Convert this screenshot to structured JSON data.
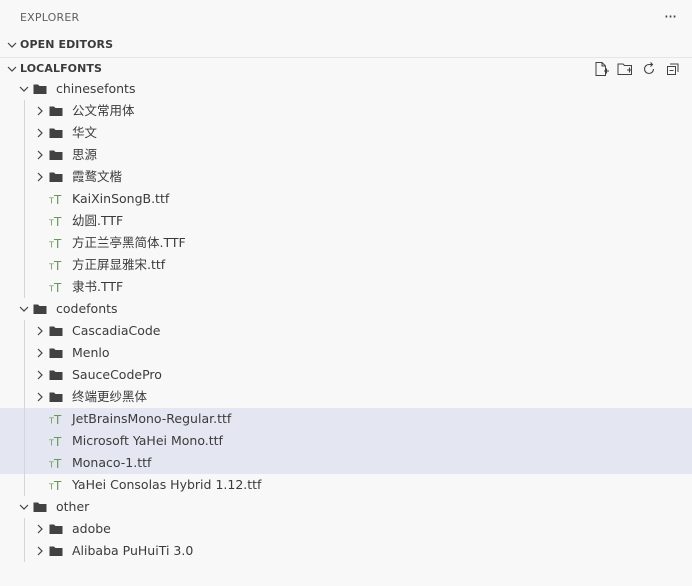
{
  "header": {
    "title": "EXPLORER",
    "more_icon": "ellipsis-icon"
  },
  "open_editors": {
    "title": "OPEN EDITORS"
  },
  "workspace": {
    "title": "LOCALFONTS",
    "actions": [
      "new-file-icon",
      "new-folder-icon",
      "refresh-icon",
      "collapse-all-icon"
    ]
  },
  "colors": {
    "background": "#f8f8f8",
    "selection": "#e4e6f1",
    "font_icon": "#6a9955",
    "folder_icon": "#424242"
  },
  "tree": [
    {
      "label": "chinesefonts",
      "type": "folder",
      "depth": 0,
      "expanded": true
    },
    {
      "label": "公文常用体",
      "type": "folder",
      "depth": 1,
      "expanded": false
    },
    {
      "label": "华文",
      "type": "folder",
      "depth": 1,
      "expanded": false
    },
    {
      "label": "思源",
      "type": "folder",
      "depth": 1,
      "expanded": false
    },
    {
      "label": "霞鹜文楷",
      "type": "folder",
      "depth": 1,
      "expanded": false
    },
    {
      "label": "KaiXinSongB.ttf",
      "type": "font",
      "depth": 1
    },
    {
      "label": "幼圆.TTF",
      "type": "font",
      "depth": 1
    },
    {
      "label": "方正兰亭黑简体.TTF",
      "type": "font",
      "depth": 1
    },
    {
      "label": "方正屏显雅宋.ttf",
      "type": "font",
      "depth": 1
    },
    {
      "label": "隶书.TTF",
      "type": "font",
      "depth": 1
    },
    {
      "label": "codefonts",
      "type": "folder",
      "depth": 0,
      "expanded": true
    },
    {
      "label": "CascadiaCode",
      "type": "folder",
      "depth": 1,
      "expanded": false
    },
    {
      "label": "Menlo",
      "type": "folder",
      "depth": 1,
      "expanded": false
    },
    {
      "label": "SauceCodePro",
      "type": "folder",
      "depth": 1,
      "expanded": false
    },
    {
      "label": "终端更纱黑体",
      "type": "folder",
      "depth": 1,
      "expanded": false
    },
    {
      "label": "JetBrainsMono-Regular.ttf",
      "type": "font",
      "depth": 1,
      "selected": true
    },
    {
      "label": "Microsoft YaHei Mono.ttf",
      "type": "font",
      "depth": 1,
      "selected": true
    },
    {
      "label": "Monaco-1.ttf",
      "type": "font",
      "depth": 1,
      "selected": true
    },
    {
      "label": "YaHei Consolas Hybrid 1.12.ttf",
      "type": "font",
      "depth": 1
    },
    {
      "label": "other",
      "type": "folder",
      "depth": 0,
      "expanded": true
    },
    {
      "label": "adobe",
      "type": "folder",
      "depth": 1,
      "expanded": false
    },
    {
      "label": "Alibaba PuHuiTi 3.0",
      "type": "folder",
      "depth": 1,
      "expanded": false
    }
  ]
}
